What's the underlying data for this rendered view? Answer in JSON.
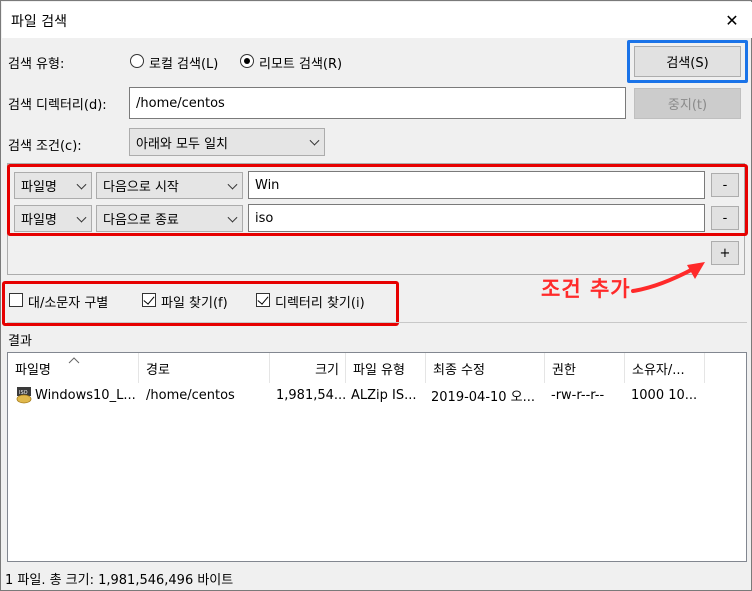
{
  "window": {
    "title": "파일 검색",
    "close_glyph": "✕"
  },
  "search_type": {
    "label": "검색 유형:",
    "options": [
      {
        "label": "로컬 검색(L)",
        "selected": false
      },
      {
        "label": "리모트 검색(R)",
        "selected": true
      }
    ]
  },
  "search_dir": {
    "label": "검색 디렉터리(d):",
    "value": "/home/centos"
  },
  "search_cond": {
    "label": "검색 조건(c):",
    "value": "아래와 모두 일치"
  },
  "buttons": {
    "search": "검색(S)",
    "stop": "중지(t)"
  },
  "conditions": [
    {
      "field": "파일명",
      "operator": "다음으로 시작",
      "value": "Win",
      "remove": "-"
    },
    {
      "field": "파일명",
      "operator": "다음으로 종료",
      "value": "iso",
      "remove": "-"
    }
  ],
  "add_condition": "+",
  "annotation": "조건 추가",
  "options": [
    {
      "label": "대/소문자 구별",
      "checked": false
    },
    {
      "label": "파일 찾기(f)",
      "checked": true
    },
    {
      "label": "디렉터리 찾기(i)",
      "checked": true
    }
  ],
  "results": {
    "label": "결과",
    "columns": [
      "파일명",
      "경로",
      "크기",
      "파일 유형",
      "최종 수정",
      "권한",
      "소유자/..."
    ],
    "rows": [
      [
        "Windows10_L...",
        "/home/centos",
        "1,981,54...",
        "ALZip IS...",
        "2019-04-10 오...",
        "-rw-r--r--",
        "1000 10..."
      ]
    ]
  },
  "status": "1 파일. 총 크기: 1,981,546,496 바이트",
  "colors": {
    "highlight_red": "#e60000",
    "highlight_blue": "#1a73e8",
    "annotation_text": "#ff2a2a"
  }
}
